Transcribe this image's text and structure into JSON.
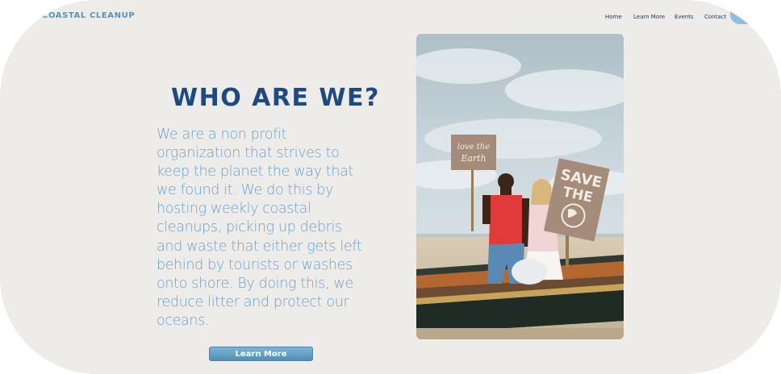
{
  "header": {
    "brand": "COASTAL CLEANUP",
    "nav": [
      "Home",
      "Learn More",
      "Events",
      "Contact"
    ]
  },
  "main": {
    "heading": "WHO ARE WE?",
    "paragraph": "We are a non profit organization that strives to keep the planet the way that we found it. We do this by hosting weekly coastal cleanups, picking up debris and waste that either gets left behind by tourists or washes onto shore. By doing this, we reduce litter and protect our oceans.",
    "button_label": "Learn More"
  },
  "photo": {
    "sign_left": "love the Earth",
    "sign_right_line1": "SAVE",
    "sign_right_line2": "THE"
  },
  "colors": {
    "background": "#eeece8",
    "heading": "#1d4a82",
    "body_text": "#6aa2cf",
    "brand": "#4f95c4",
    "button": "#5b9cc4"
  }
}
